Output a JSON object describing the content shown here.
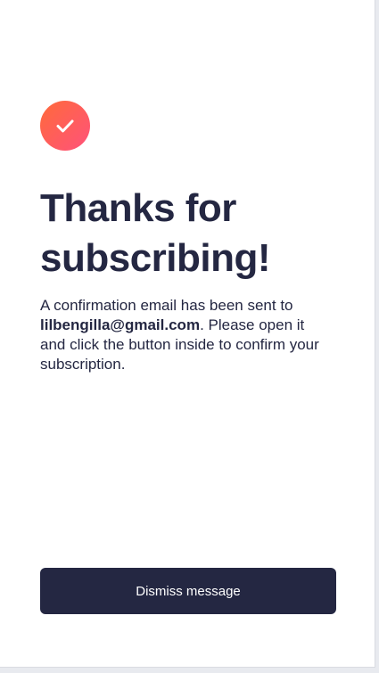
{
  "confirmation": {
    "icon": "check-icon",
    "title": "Thanks for subscribing!",
    "message_before": "A confirmation email has been sent to ",
    "email": "lilbengilla@gmail.com",
    "message_after": ". Please open it and click the button inside to confirm your subscription.",
    "dismiss_label": "Dismiss message"
  },
  "colors": {
    "heading": "#242742",
    "button": "#242742",
    "icon_gradient_start": "#ff6a3a",
    "icon_gradient_end": "#ff527b",
    "background": "#ffffff"
  }
}
